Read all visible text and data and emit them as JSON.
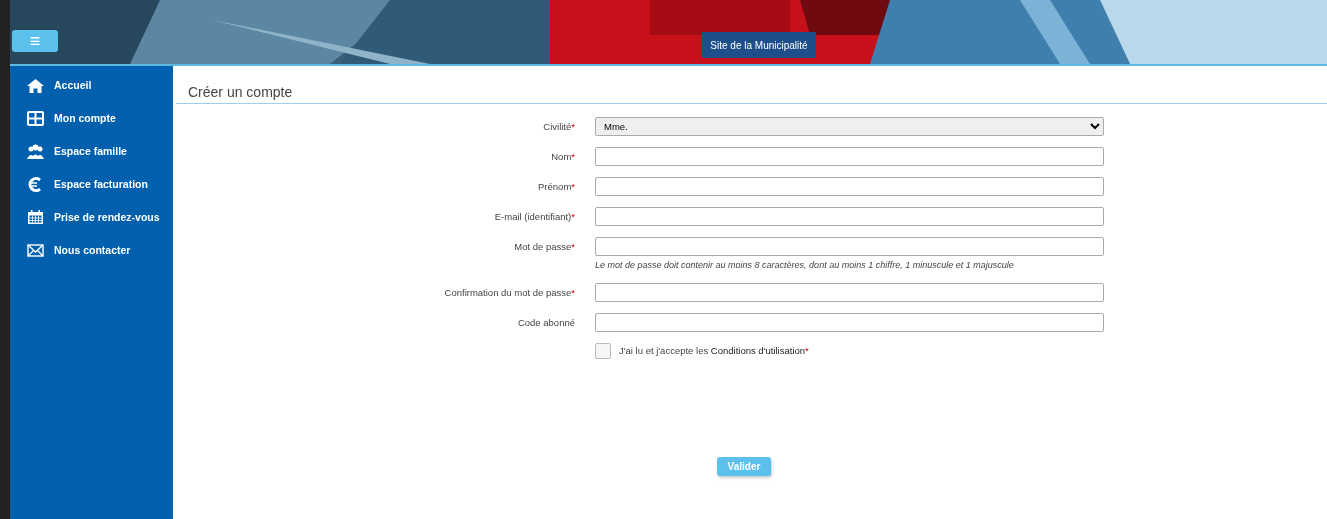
{
  "header": {
    "menu_button": "≡",
    "site_link": "Site de la Municipalité"
  },
  "sidebar": {
    "items": [
      {
        "label": "Accueil"
      },
      {
        "label": "Mon compte"
      },
      {
        "label": "Espace famille"
      },
      {
        "label": "Espace facturation"
      },
      {
        "label": "Prise de rendez-vous"
      },
      {
        "label": "Nous contacter"
      }
    ]
  },
  "page_title": "Créer un compte",
  "form": {
    "fields": [
      {
        "kind": "select",
        "label": "Civilité",
        "required_mark": "*",
        "value": "Mme."
      },
      {
        "kind": "text",
        "label": "Nom",
        "required_mark": "*"
      },
      {
        "kind": "text",
        "label": "Prénom",
        "required_mark": "*"
      },
      {
        "kind": "text",
        "label": "E-mail (identifiant)",
        "required_mark": "*"
      },
      {
        "kind": "password",
        "label": "Mot de passe",
        "required_mark": "*",
        "hint": "Le mot de passe doit contenir au moins 8 caractères, dont au moins 1 chiffre, 1 minuscule et 1 majuscule"
      },
      {
        "kind": "password",
        "label": "Confirmation du mot de passe",
        "required_mark": "*"
      },
      {
        "kind": "text",
        "label": "Code abonné"
      }
    ],
    "terms": {
      "checked": false,
      "text": "J'ai lu et j'accepte les **Conditions d'utilisation**",
      "required_mark": "*"
    },
    "submit": "Valider"
  }
}
